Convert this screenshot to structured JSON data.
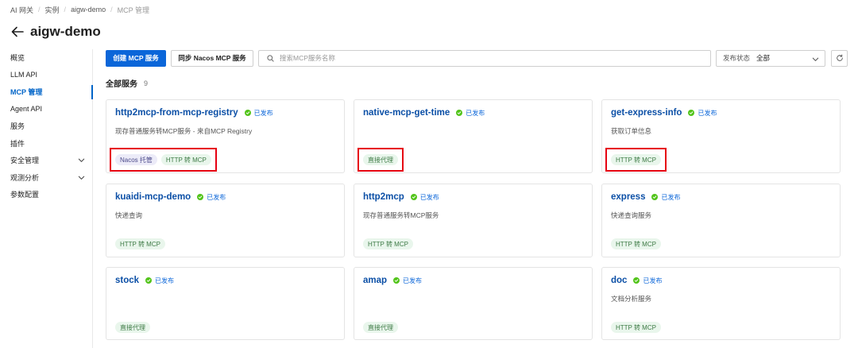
{
  "breadcrumb": [
    "AI 网关",
    "实例",
    "aigw-demo",
    "MCP 管理"
  ],
  "page_title": "aigw-demo",
  "sidebar": {
    "items": [
      {
        "label": "概览",
        "active": false,
        "expandable": false
      },
      {
        "label": "LLM API",
        "active": false,
        "expandable": false
      },
      {
        "label": "MCP 管理",
        "active": true,
        "expandable": false
      },
      {
        "label": "Agent API",
        "active": false,
        "expandable": false
      },
      {
        "label": "服务",
        "active": false,
        "expandable": false
      },
      {
        "label": "插件",
        "active": false,
        "expandable": false
      },
      {
        "label": "安全管理",
        "active": false,
        "expandable": true
      },
      {
        "label": "观测分析",
        "active": false,
        "expandable": true
      },
      {
        "label": "参数配置",
        "active": false,
        "expandable": false
      }
    ]
  },
  "toolbar": {
    "create_label": "创建 MCP 服务",
    "sync_label": "同步 Nacos MCP 服务",
    "search_placeholder": "搜索MCP服务名称",
    "status_label": "发布状态",
    "status_value": "全部"
  },
  "section": {
    "title": "全部服务",
    "count": "9"
  },
  "colors": {
    "primary": "#0b66d9",
    "published": "#52c41a",
    "highlight": "#e60012"
  },
  "services": [
    {
      "name": "http2mcp-from-mcp-registry",
      "status": "已发布",
      "desc": "现存普通服务转MCP服务 - 来自MCP Registry",
      "tags": [
        {
          "text": "Nacos 托管",
          "style": "purple"
        },
        {
          "text": "HTTP 转 MCP",
          "style": "green"
        }
      ],
      "highlighted": true
    },
    {
      "name": "native-mcp-get-time",
      "status": "已发布",
      "desc": "",
      "tags": [
        {
          "text": "直接代理",
          "style": "green"
        }
      ],
      "highlighted": true
    },
    {
      "name": "get-express-info",
      "status": "已发布",
      "desc": "获取订单信息",
      "tags": [
        {
          "text": "HTTP 转 MCP",
          "style": "green"
        }
      ],
      "highlighted": true
    },
    {
      "name": "kuaidi-mcp-demo",
      "status": "已发布",
      "desc": "快递查询",
      "tags": [
        {
          "text": "HTTP 转 MCP",
          "style": "green"
        }
      ],
      "highlighted": false
    },
    {
      "name": "http2mcp",
      "status": "已发布",
      "desc": "现存普通服务转MCP服务",
      "tags": [
        {
          "text": "HTTP 转 MCP",
          "style": "green"
        }
      ],
      "highlighted": false
    },
    {
      "name": "express",
      "status": "已发布",
      "desc": "快递查询服务",
      "tags": [
        {
          "text": "HTTP 转 MCP",
          "style": "green"
        }
      ],
      "highlighted": false
    },
    {
      "name": "stock",
      "status": "已发布",
      "desc": "",
      "tags": [
        {
          "text": "直接代理",
          "style": "green"
        }
      ],
      "highlighted": false
    },
    {
      "name": "amap",
      "status": "已发布",
      "desc": "",
      "tags": [
        {
          "text": "直接代理",
          "style": "green"
        }
      ],
      "highlighted": false
    },
    {
      "name": "doc",
      "status": "已发布",
      "desc": "文档分析服务",
      "tags": [
        {
          "text": "HTTP 转 MCP",
          "style": "green"
        }
      ],
      "highlighted": false
    }
  ]
}
